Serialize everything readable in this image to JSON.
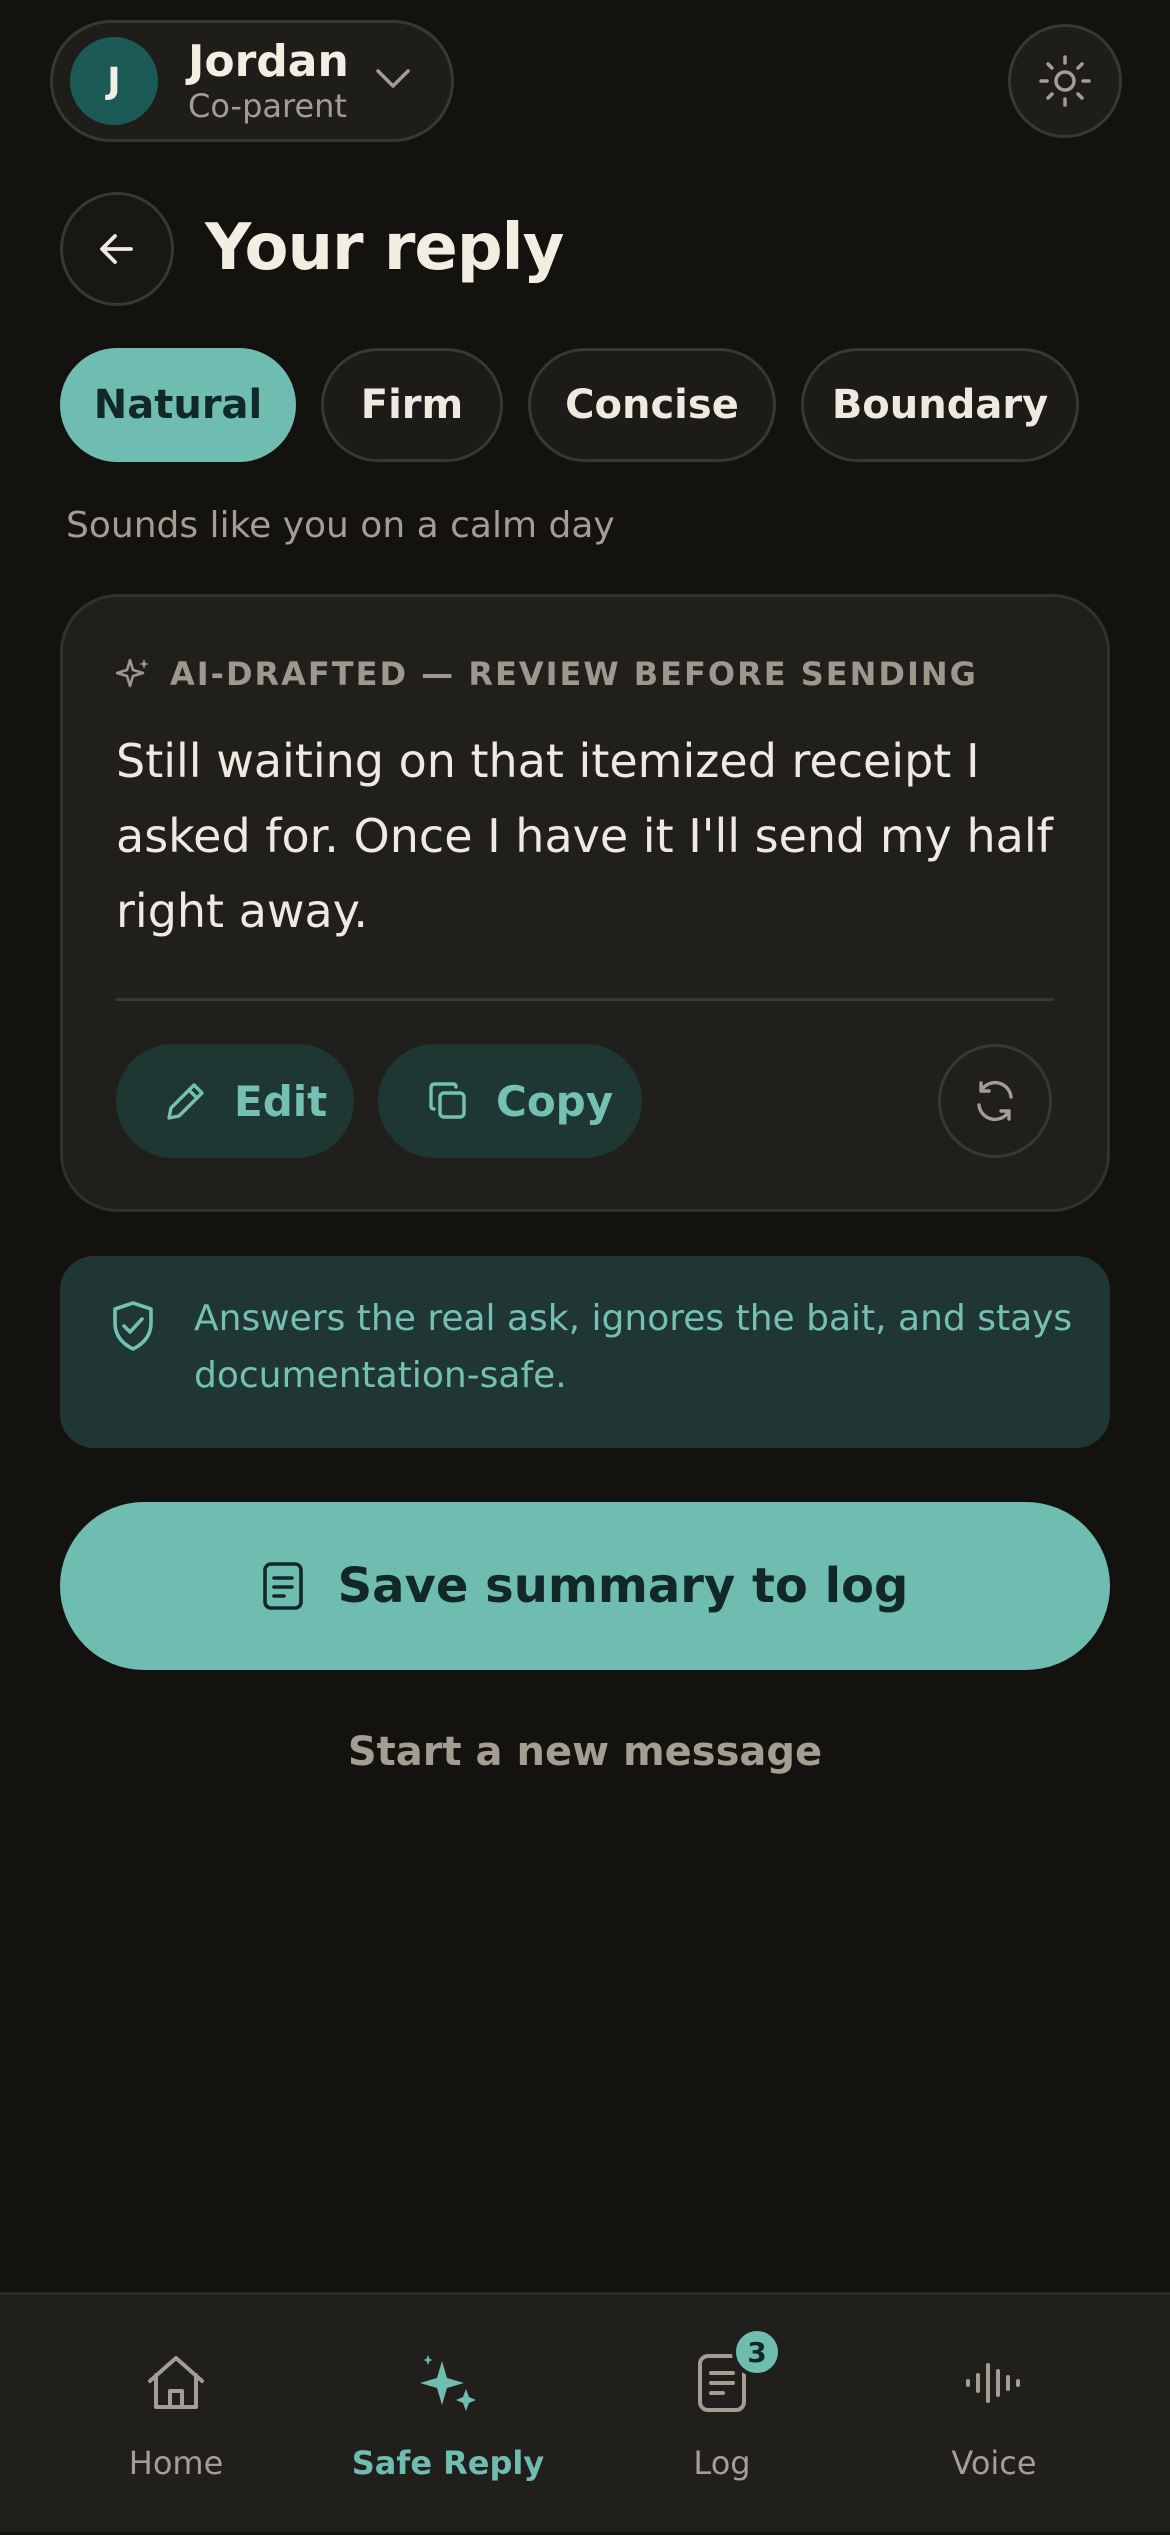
{
  "header": {
    "avatar_initial": "J",
    "name": "Jordan",
    "role": "Co-parent"
  },
  "page": {
    "title": "Your reply"
  },
  "tones": {
    "items": [
      {
        "label": "Natural",
        "active": true
      },
      {
        "label": "Firm",
        "active": false
      },
      {
        "label": "Concise",
        "active": false
      },
      {
        "label": "Boundary",
        "active": false
      }
    ],
    "description": "Sounds like you on a calm day"
  },
  "draft": {
    "label": "AI-DRAFTED — REVIEW BEFORE SENDING",
    "text": "Still waiting on that itemized receipt I asked for. Once I have it I'll send my half right away.",
    "edit_label": "Edit",
    "copy_label": "Copy"
  },
  "note": {
    "text": "Answers the real ask, ignores the bait, and stays documentation-safe."
  },
  "actions": {
    "save_label": "Save summary to log",
    "new_message_label": "Start a new message"
  },
  "nav": {
    "items": [
      {
        "label": "Home",
        "icon": "home-icon"
      },
      {
        "label": "Safe Reply",
        "icon": "sparkle-icon",
        "active": true
      },
      {
        "label": "Log",
        "icon": "document-icon",
        "badge": "3"
      },
      {
        "label": "Voice",
        "icon": "waveform-icon"
      }
    ]
  },
  "colors": {
    "background": "#13120f",
    "accent": "#6fbdb1",
    "accent_dark": "#1f3733",
    "card": "#211f1b",
    "text_muted": "#a39d92"
  }
}
